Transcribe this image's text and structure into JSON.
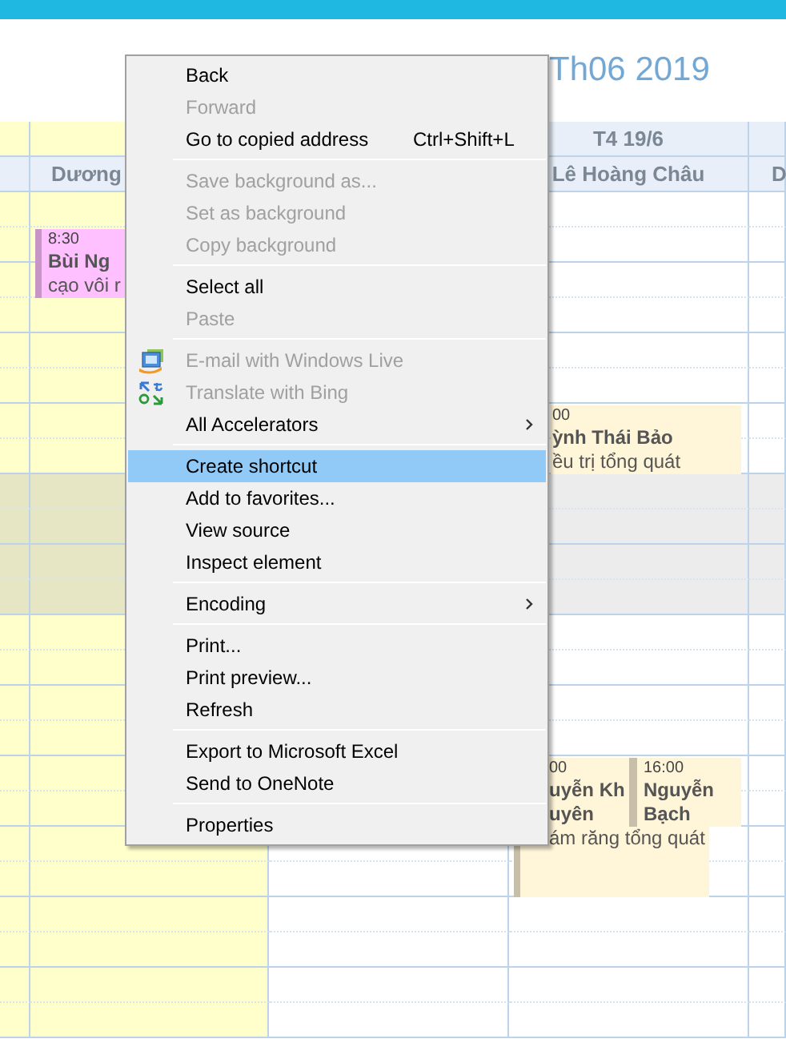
{
  "title": "Th06 2019",
  "calendar": {
    "columns": [
      {
        "tinted": true
      },
      {
        "name": "Dương",
        "tinted": true
      },
      {
        "tinted": false
      },
      {
        "day": "T4 19/6",
        "name": "Lê Hoàng Châu",
        "tinted": false
      },
      {
        "name": "D",
        "tinted": false
      }
    ],
    "slots": [
      {
        "shaded": false
      },
      {
        "shaded": false
      },
      {
        "shaded": false
      },
      {
        "shaded": false
      },
      {
        "shaded": false
      },
      {
        "shaded": false
      },
      {
        "shaded": false
      },
      {
        "shaded": false
      },
      {
        "shaded": true
      },
      {
        "shaded": true
      },
      {
        "shaded": true
      },
      {
        "shaded": true
      },
      {
        "shaded": false
      },
      {
        "shaded": false
      },
      {
        "shaded": false
      },
      {
        "shaded": false
      },
      {
        "shaded": false
      },
      {
        "shaded": false
      },
      {
        "shaded": false
      },
      {
        "shaded": false
      },
      {
        "shaded": false
      },
      {
        "shaded": false
      },
      {
        "shaded": false
      },
      {
        "shaded": false
      }
    ],
    "events": [
      {
        "time": "8:30",
        "patient": [
          "Bùi Ng"
        ],
        "service": "cạo vôi r",
        "color": "#ffc0ff"
      },
      {
        "time": "00",
        "patient": [
          "ỳnh Thái Bảo"
        ],
        "service": "ều trị tổng quát",
        "color": "#fff5d9"
      },
      {
        "time": "00",
        "patient": [
          "uyễn Kh",
          "uyên"
        ],
        "service": "ám răng tổng quát",
        "color": "#fff5d9"
      },
      {
        "time": "16:00",
        "patient": [
          "Nguyễn",
          "Bạch"
        ],
        "color": "#fff5d9"
      }
    ]
  },
  "context_menu": {
    "groups": [
      [
        {
          "label": "Back",
          "disabled": false,
          "selected": false
        },
        {
          "label": "Forward",
          "disabled": true,
          "selected": false
        },
        {
          "label": "Go to copied address",
          "shortcut": "Ctrl+Shift+L",
          "disabled": false,
          "selected": false
        }
      ],
      [
        {
          "label": "Save background as...",
          "disabled": true,
          "selected": false
        },
        {
          "label": "Set as background",
          "disabled": true,
          "selected": false
        },
        {
          "label": "Copy background",
          "disabled": true,
          "selected": false
        }
      ],
      [
        {
          "label": "Select all",
          "disabled": false,
          "selected": false
        },
        {
          "label": "Paste",
          "disabled": true,
          "selected": false
        }
      ],
      [
        {
          "label": "E-mail with Windows Live",
          "kind": "mail",
          "disabled": true,
          "selected": false
        },
        {
          "label": "Translate with Bing",
          "kind": "translate",
          "disabled": true,
          "selected": false
        },
        {
          "label": "All Accelerators",
          "submenu": true,
          "disabled": false,
          "selected": false
        }
      ],
      [
        {
          "label": "Create shortcut",
          "disabled": false,
          "selected": true
        },
        {
          "label": "Add to favorites...",
          "disabled": false,
          "selected": false
        },
        {
          "label": "View source",
          "disabled": false,
          "selected": false
        },
        {
          "label": "Inspect element",
          "disabled": false,
          "selected": false
        }
      ],
      [
        {
          "label": "Encoding",
          "submenu": true,
          "disabled": false,
          "selected": false
        }
      ],
      [
        {
          "label": "Print...",
          "disabled": false,
          "selected": false
        },
        {
          "label": "Print preview...",
          "disabled": false,
          "selected": false
        },
        {
          "label": "Refresh",
          "disabled": false,
          "selected": false
        }
      ],
      [
        {
          "label": "Export to Microsoft Excel",
          "disabled": false,
          "selected": false
        },
        {
          "label": "Send to OneNote",
          "disabled": false,
          "selected": false
        }
      ],
      [
        {
          "label": "Properties",
          "disabled": false,
          "selected": false
        }
      ]
    ]
  }
}
